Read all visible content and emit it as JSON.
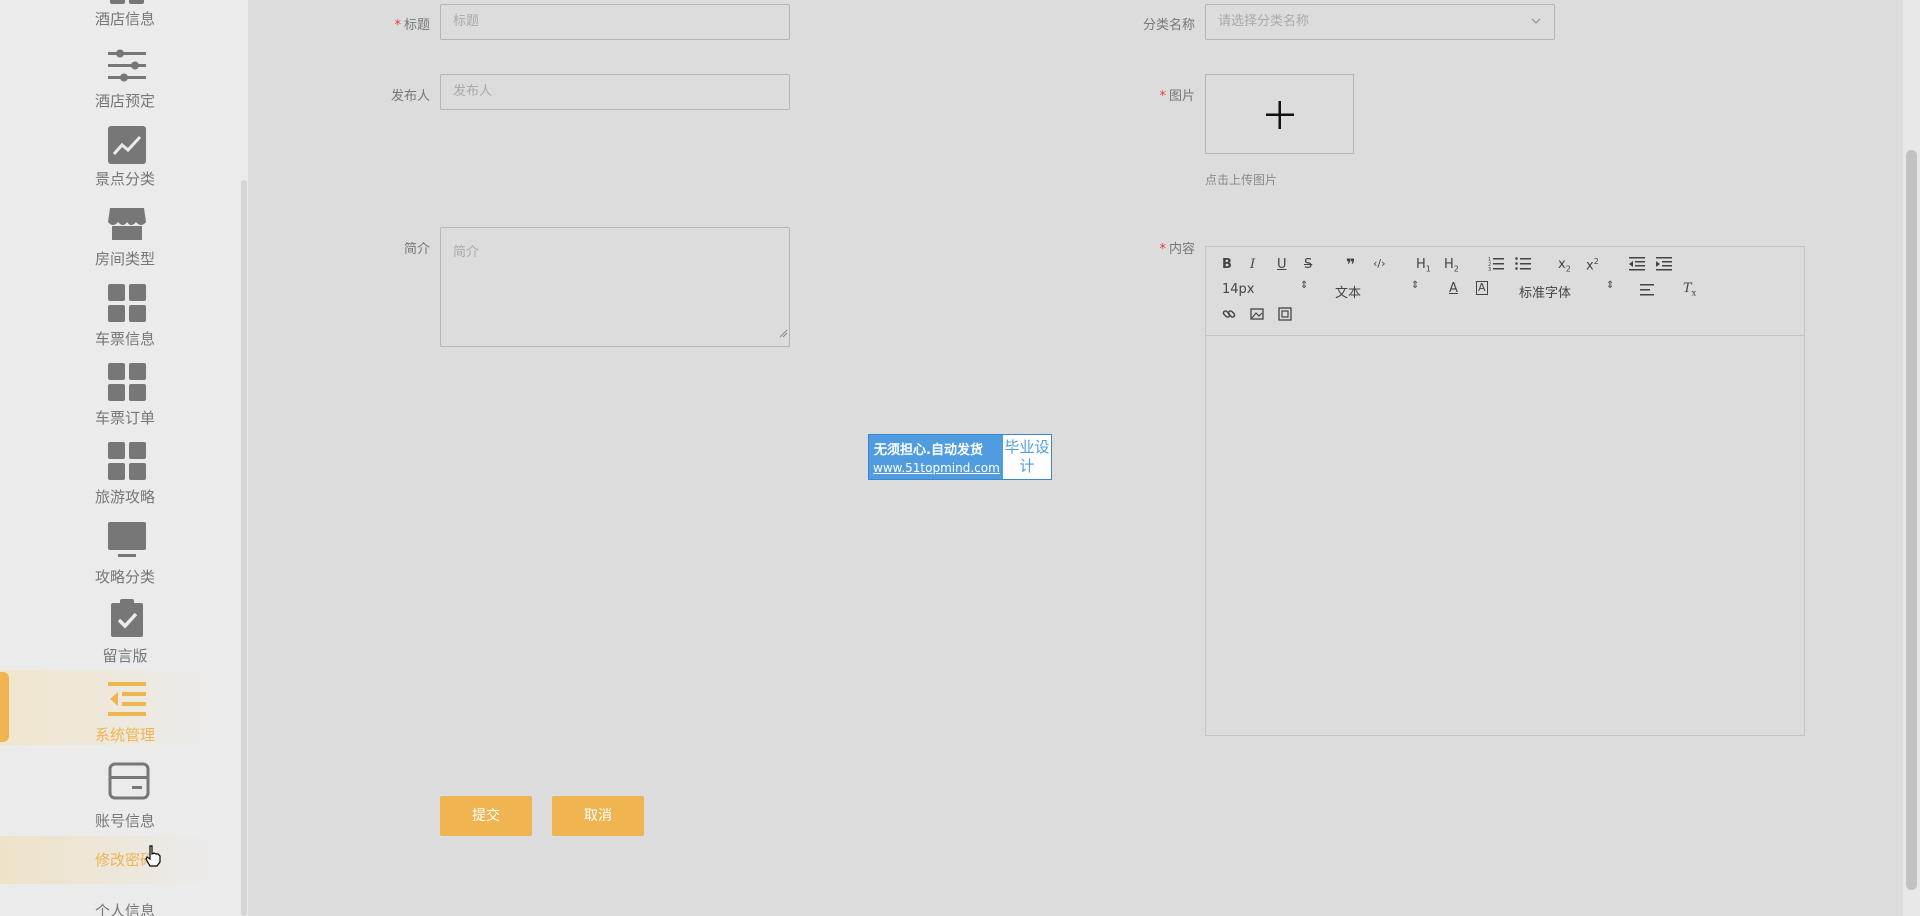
{
  "sidebar": {
    "items": [
      {
        "label": "酒店信息",
        "icon": "grid-icon"
      },
      {
        "label": "酒店预定",
        "icon": "sliders-icon"
      },
      {
        "label": "景点分类",
        "icon": "chart-line-icon"
      },
      {
        "label": "房间类型",
        "icon": "store-icon"
      },
      {
        "label": "车票信息",
        "icon": "grid-icon"
      },
      {
        "label": "车票订单",
        "icon": "grid-icon"
      },
      {
        "label": "旅游攻略",
        "icon": "grid-icon"
      },
      {
        "label": "攻略分类",
        "icon": "monitor-icon"
      },
      {
        "label": "留言版",
        "icon": "clipboard-check-icon"
      },
      {
        "label": "系统管理",
        "icon": "list-indent-icon",
        "active": true
      },
      {
        "label": "账号信息",
        "icon": "card-icon"
      },
      {
        "label": "修改密码",
        "active": true
      },
      {
        "label": "个人信息"
      }
    ]
  },
  "form": {
    "title_label": "标题",
    "title_placeholder": "标题",
    "category_label": "分类名称",
    "category_placeholder": "请选择分类名称",
    "publisher_label": "发布人",
    "publisher_placeholder": "发布人",
    "image_label": "图片",
    "image_hint": "点击上传图片",
    "intro_label": "简介",
    "intro_placeholder": "简介",
    "content_label": "内容"
  },
  "editor": {
    "font_size": "14px",
    "paragraph": "文本",
    "font_family": "标准字体",
    "h1": "H",
    "h2": "H"
  },
  "buttons": {
    "submit": "提交",
    "cancel": "取消"
  },
  "watermark": {
    "line1": "无须担心.自动发货",
    "line2": "www.51topmind.com",
    "side": "毕业设计"
  },
  "colors": {
    "accent": "#f0b450",
    "required": "#e2423e",
    "watermark_blue": "#4f9ce0"
  }
}
